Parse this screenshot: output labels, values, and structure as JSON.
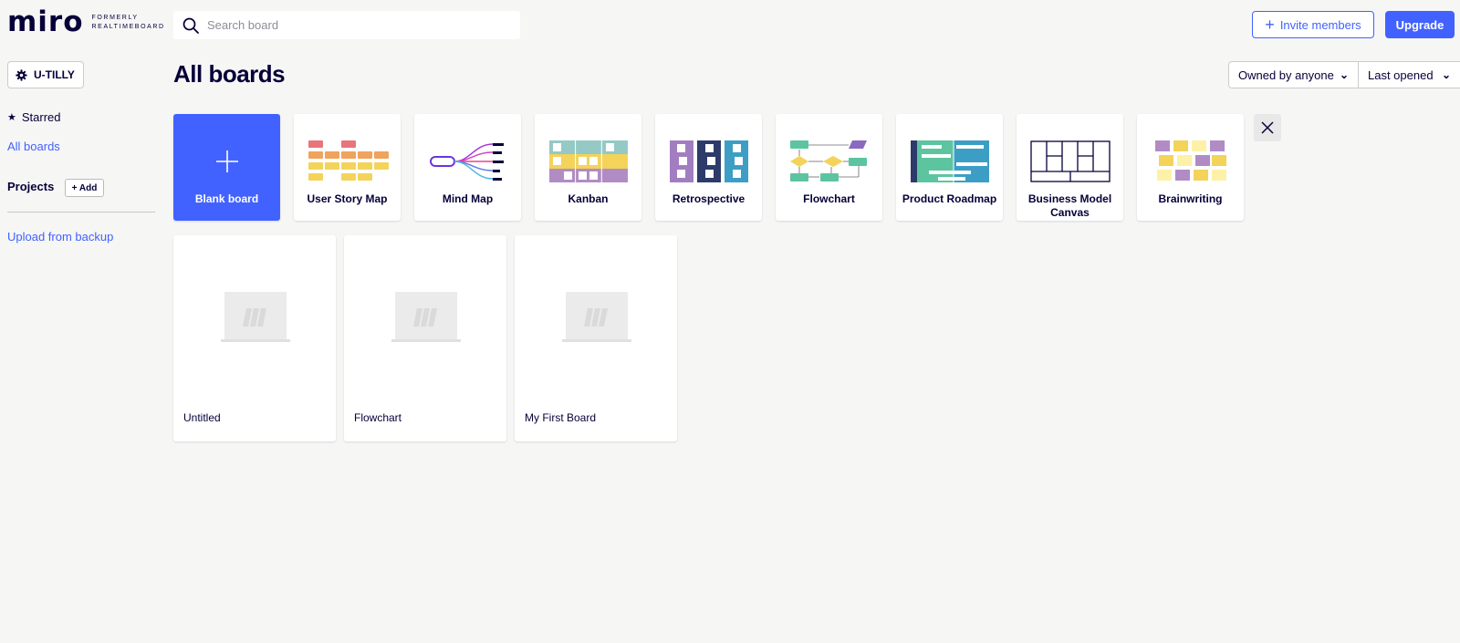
{
  "header": {
    "logo": "miro",
    "logo_sub_1": "FORMERLY",
    "logo_sub_2": "REALTIMEBOARD",
    "search_placeholder": "Search board",
    "invite_label": "Invite members",
    "upgrade_label": "Upgrade"
  },
  "sidebar": {
    "team_label": "U-TILLY",
    "starred_label": "Starred",
    "all_boards_label": "All boards",
    "projects_label": "Projects",
    "add_label": "+ Add",
    "upload_label": "Upload from backup"
  },
  "main": {
    "title": "All boards",
    "filter_owner": "Owned by anyone",
    "filter_sort": "Last opened",
    "templates": [
      {
        "label": "Blank board",
        "icon": "plus-icon"
      },
      {
        "label": "User Story Map",
        "icon": "user-story-map-icon"
      },
      {
        "label": "Mind Map",
        "icon": "mind-map-icon"
      },
      {
        "label": "Kanban",
        "icon": "kanban-icon"
      },
      {
        "label": "Retrospective",
        "icon": "retrospective-icon"
      },
      {
        "label": "Flowchart",
        "icon": "flowchart-icon"
      },
      {
        "label": "Product Roadmap",
        "icon": "product-roadmap-icon"
      },
      {
        "label": "Business Model Canvas",
        "icon": "business-model-canvas-icon"
      },
      {
        "label": "Brainwriting",
        "icon": "brainwriting-icon"
      }
    ],
    "boards": [
      {
        "name": "Untitled"
      },
      {
        "name": "Flowchart"
      },
      {
        "name": "My First Board"
      }
    ]
  },
  "colors": {
    "accent": "#4262ff",
    "background": "#f6f6f5",
    "text": "#050038"
  }
}
